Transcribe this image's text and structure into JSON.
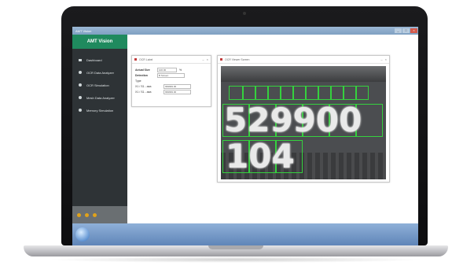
{
  "window": {
    "title": "AMT Vision",
    "controls": [
      "_",
      "□",
      "×"
    ]
  },
  "sidebar": {
    "brand": "AMT Vision",
    "items": [
      {
        "label": "Dashboard",
        "icon": "square-icon"
      },
      {
        "label": "OCR Data Analyzer",
        "icon": "circle-icon"
      },
      {
        "label": "OCR Simulation",
        "icon": "circle-icon"
      },
      {
        "label": "Mesh Data Analyzer",
        "icon": "circle-icon"
      },
      {
        "label": "Memory Simulation",
        "icon": "circle-icon"
      }
    ]
  },
  "ocr_panel": {
    "title": "OCR Label",
    "actual_size_label": "Actual Size",
    "actual_size_value": "100.00",
    "actual_size_unit": "%",
    "detection_label": "Detection",
    "detection_value": "B Screen",
    "type_label": "Type",
    "row1_label": "X1 / S1 - aaa",
    "row1_value": "999999.00",
    "row2_label": "X1 / S1 - aaa",
    "row2_value": "999999.00"
  },
  "viewer_panel": {
    "title": "OCR Viewer Screen",
    "digits_top": "529900",
    "digits_bottom": "104"
  },
  "colors": {
    "brand": "#1f8a5e",
    "sidebar": "#2e3336",
    "box": "#35d13e",
    "accent": "#c23b3b"
  }
}
